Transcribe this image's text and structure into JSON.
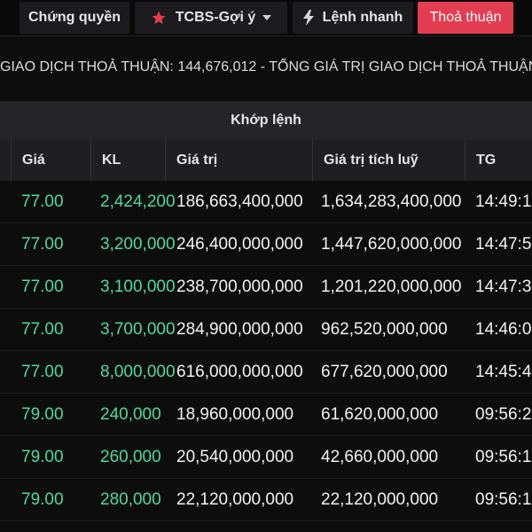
{
  "tabs": {
    "chung_quyen": "Chứng quyền",
    "tcbs": "TCBS-Gợi ý",
    "lenh_nhanh": "Lệnh nhanh",
    "thoa_thuan": "Thoả thuận",
    "active": "Thoả thuận",
    "active_color": "#e33d52"
  },
  "summary": {
    "text": "GIAO DỊCH THOẢ THUẬN: 144,676,012 - TỔNG GIÁ TRỊ GIAO DỊCH THOẢ THUẬN"
  },
  "table": {
    "group_header": "Khớp lệnh",
    "columns": {
      "price": "Giá",
      "volume": "KL",
      "value": "Giá trị",
      "cumulative": "Giá trị tích luỹ",
      "time": "TG"
    },
    "rows": [
      {
        "price": "77.00",
        "volume": "2,424,200",
        "value": "186,663,400,000",
        "cumulative": "1,634,283,400,000",
        "time": "14:49:1"
      },
      {
        "price": "77.00",
        "volume": "3,200,000",
        "value": "246,400,000,000",
        "cumulative": "1,447,620,000,000",
        "time": "14:47:5"
      },
      {
        "price": "77.00",
        "volume": "3,100,000",
        "value": "238,700,000,000",
        "cumulative": "1,201,220,000,000",
        "time": "14:47:3"
      },
      {
        "price": "77.00",
        "volume": "3,700,000",
        "value": "284,900,000,000",
        "cumulative": "962,520,000,000",
        "time": "14:46:0"
      },
      {
        "price": "77.00",
        "volume": "8,000,000",
        "value": "616,000,000,000",
        "cumulative": "677,620,000,000",
        "time": "14:45:4"
      },
      {
        "price": "79.00",
        "volume": "240,000",
        "value": "18,960,000,000",
        "cumulative": "61,620,000,000",
        "time": "09:56:2"
      },
      {
        "price": "79.00",
        "volume": "260,000",
        "value": "20,540,000,000",
        "cumulative": "42,660,000,000",
        "time": "09:56:1"
      },
      {
        "price": "79.00",
        "volume": "280,000",
        "value": "22,120,000,000",
        "cumulative": "22,120,000,000",
        "time": "09:56:1"
      }
    ],
    "up_color": "#4ddb9c"
  },
  "icons": {
    "tcbs": "star-icon",
    "tcbs_dropdown": "chevron-down-icon",
    "lenh_nhanh": "lightning-icon"
  }
}
